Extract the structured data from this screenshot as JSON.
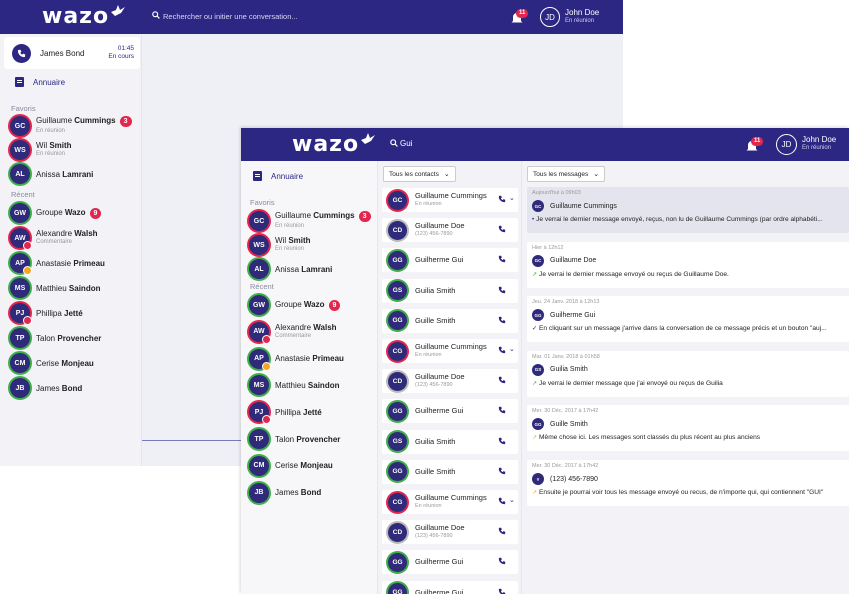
{
  "brand": {
    "logo": "wazo"
  },
  "back": {
    "search_placeholder": "Rechercher ou initier une conversation...",
    "notif_count": "11",
    "user": {
      "initials": "JD",
      "name": "John Doe",
      "status": "En réunion"
    },
    "call": {
      "name": "James Bond",
      "time": "01:45",
      "state": "En cours"
    },
    "directory_label": "Annuaire",
    "favorites_label": "Favoris",
    "recent_label": "Récent",
    "favorites": [
      {
        "initials": "GC",
        "first": "Guillaume",
        "last": "Cummings",
        "sub": "En réunion",
        "badge": "3"
      },
      {
        "initials": "WS",
        "first": "Wil",
        "last": "Smith",
        "sub": "En réunion",
        "badge": ""
      },
      {
        "initials": "AL",
        "first": "Anissa",
        "last": "Lamrani",
        "sub": "",
        "badge": ""
      }
    ],
    "recent": [
      {
        "initials": "GW",
        "first": "Groupe",
        "last": "Wazo",
        "sub": "",
        "badge": "9"
      },
      {
        "initials": "AW",
        "first": "Alexandre",
        "last": "Walsh",
        "sub": "Commentaire",
        "badge": ""
      },
      {
        "initials": "AP",
        "first": "Anastasie",
        "last": "Primeau",
        "sub": "",
        "badge": ""
      },
      {
        "initials": "MS",
        "first": "Matthieu",
        "last": "Saindon",
        "sub": "",
        "badge": ""
      },
      {
        "initials": "PJ",
        "first": "Phillipa",
        "last": "Jetté",
        "sub": "",
        "badge": ""
      },
      {
        "initials": "TP",
        "first": "Talon",
        "last": "Provencher",
        "sub": "",
        "badge": ""
      },
      {
        "initials": "CM",
        "first": "Cerise",
        "last": "Monjeau",
        "sub": "",
        "badge": ""
      },
      {
        "initials": "JB",
        "first": "James",
        "last": "Bond",
        "sub": "",
        "badge": ""
      }
    ]
  },
  "front": {
    "search_value": "Gui",
    "notif_count": "11",
    "user": {
      "initials": "JD",
      "name": "John Doe",
      "status": "En réunion"
    },
    "directory_label": "Annuaire",
    "favorites_label": "Favoris",
    "recent_label": "Récent",
    "favorites": [
      {
        "initials": "GC",
        "first": "Guillaume",
        "last": "Cummings",
        "sub": "En réunion",
        "badge": "3"
      },
      {
        "initials": "WS",
        "first": "Wil",
        "last": "Smith",
        "sub": "En réunion",
        "badge": ""
      },
      {
        "initials": "AL",
        "first": "Anissa",
        "last": "Lamrani",
        "sub": "",
        "badge": ""
      }
    ],
    "recent": [
      {
        "initials": "GW",
        "first": "Groupe",
        "last": "Wazo",
        "sub": "",
        "badge": "9"
      },
      {
        "initials": "AW",
        "first": "Alexandre",
        "last": "Walsh",
        "sub": "Commentaire",
        "badge": ""
      },
      {
        "initials": "AP",
        "first": "Anastasie",
        "last": "Primeau",
        "sub": "",
        "badge": ""
      },
      {
        "initials": "MS",
        "first": "Matthieu",
        "last": "Saindon",
        "sub": "",
        "badge": ""
      },
      {
        "initials": "PJ",
        "first": "Phillipa",
        "last": "Jetté",
        "sub": "",
        "badge": ""
      },
      {
        "initials": "TP",
        "first": "Talon",
        "last": "Provencher",
        "sub": "",
        "badge": ""
      },
      {
        "initials": "CM",
        "first": "Cerise",
        "last": "Monjeau",
        "sub": "",
        "badge": ""
      },
      {
        "initials": "JB",
        "first": "James",
        "last": "Bond",
        "sub": "",
        "badge": ""
      }
    ],
    "contacts_filter": "Tous les contacts",
    "messages_filter": "Tous les messages",
    "search_results": [
      {
        "initials": "GC",
        "name": "Guillaume Cummings",
        "sub": "En réunion"
      },
      {
        "initials": "CD",
        "name": "Guillaume Doe",
        "sub": "(123) 456-7890"
      },
      {
        "initials": "GG",
        "name": "Guilherme Gui",
        "sub": ""
      },
      {
        "initials": "GS",
        "name": "Guilia Smith",
        "sub": ""
      },
      {
        "initials": "GG",
        "name": "Guille Smith",
        "sub": ""
      },
      {
        "initials": "CG",
        "name": "Guillaume Cummings",
        "sub": "En réunion"
      },
      {
        "initials": "CD",
        "name": "Guillaume Doe",
        "sub": "(123) 456-7890"
      },
      {
        "initials": "GG",
        "name": "Guilherme Gui",
        "sub": ""
      },
      {
        "initials": "GS",
        "name": "Guilia Smith",
        "sub": ""
      },
      {
        "initials": "GG",
        "name": "Guille Smith",
        "sub": ""
      },
      {
        "initials": "CG",
        "name": "Guillaume Cummings",
        "sub": "En réunion"
      },
      {
        "initials": "CD",
        "name": "Guillaume Doe",
        "sub": "(123) 456-7890"
      },
      {
        "initials": "GG",
        "name": "Guilherme Gui",
        "sub": ""
      },
      {
        "initials": "GG",
        "name": "Guilherme Gui",
        "sub": ""
      }
    ],
    "messages": [
      {
        "date": "Aujourd'hui à 09h03",
        "initials": "GC",
        "name": "Guillaume Cummings",
        "text": "Je verrai le dernier message envoyé, reçus, non lu de Guillaume Cummings (par ordre alphabéti..."
      },
      {
        "date": "Hier à 12h12",
        "initials": "GC",
        "name": "Guillaume Doe",
        "text": "Je verrai le dernier message envoyé ou reçus de Guillaume Doe."
      },
      {
        "date": "Jeu. 24 Janv. 2018 à 12h13",
        "initials": "GG",
        "name": "Guilherme Gui",
        "text": "En cliquant sur un message j'arrive dans la conversation de ce message précis et un bouton \"auj..."
      },
      {
        "date": "Mar. 01 Janv. 2018 à 01h58",
        "initials": "GS",
        "name": "Guilia Smith",
        "text": "Je verrai le dernier message que j'ai envoyé ou reçus de Guilia"
      },
      {
        "date": "Mer. 30 Déc. 2017 à 17h42",
        "initials": "GG",
        "name": "Guille Smith",
        "text": "Même chose ici. Les messages sont classés du plus récent au plus anciens"
      },
      {
        "date": "Mer. 30 Déc. 2017 à 17h42",
        "initials": "#",
        "name": "(123) 456-7890",
        "text": "Ensuite je pourrai voir tous les message envoyé ou recus, de n'importe qui, qui contiennent \"GUI\""
      }
    ]
  }
}
